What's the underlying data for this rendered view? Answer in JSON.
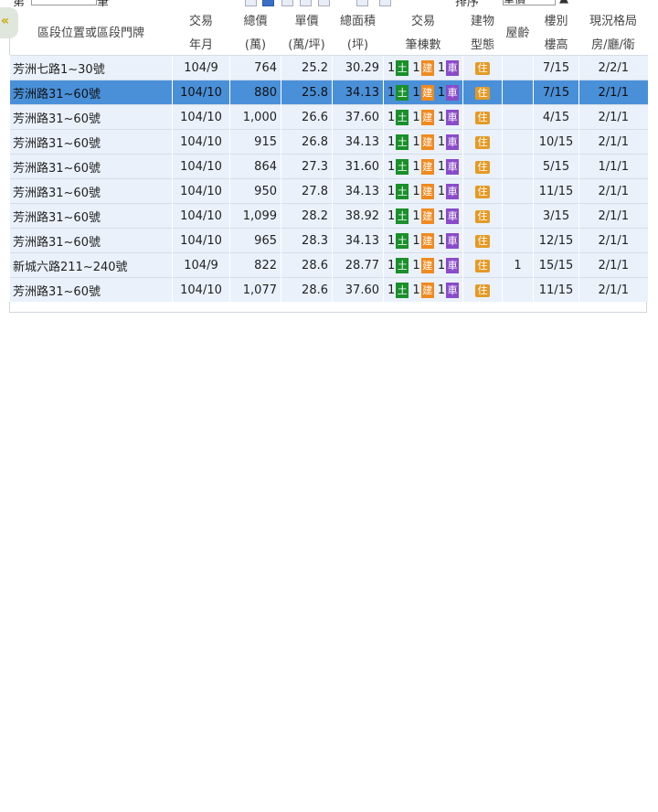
{
  "top_strip": {
    "prefix": "第",
    "suffix": "筆",
    "sort_label": "排序",
    "sort_value": "單價"
  },
  "collapse_label": "«",
  "headers": {
    "address": "區段位置或區段門牌",
    "date": [
      "交易",
      "年月"
    ],
    "total": [
      "總價",
      "(萬)"
    ],
    "unit": [
      "單價",
      "(萬/坪)"
    ],
    "area": [
      "總面積",
      "(坪)"
    ],
    "count": [
      "交易",
      "筆棟數"
    ],
    "type": [
      "建物",
      "型態"
    ],
    "age": "屋齡",
    "floor": [
      "樓別",
      "樓高"
    ],
    "layout": [
      "現況格局",
      "房/廳/衛"
    ]
  },
  "badges": {
    "land": "土",
    "building": "建",
    "parking": "車",
    "residential": "住"
  },
  "rows": [
    {
      "addr": "芳洲七路1~30號",
      "date": "104/9",
      "total": "764",
      "unit": "25.2",
      "area": "30.29",
      "land": "1",
      "bldg": "1",
      "park": "1",
      "type": "住",
      "age": "",
      "floor": "7/15",
      "layout": "2/2/1"
    },
    {
      "addr": "芳洲路31~60號",
      "date": "104/10",
      "total": "880",
      "unit": "25.8",
      "area": "34.13",
      "land": "1",
      "bldg": "1",
      "park": "1",
      "type": "住",
      "age": "",
      "floor": "7/15",
      "layout": "2/1/1"
    },
    {
      "addr": "芳洲路31~60號",
      "date": "104/10",
      "total": "1,000",
      "unit": "26.6",
      "area": "37.60",
      "land": "1",
      "bldg": "1",
      "park": "1",
      "type": "住",
      "age": "",
      "floor": "4/15",
      "layout": "2/1/1"
    },
    {
      "addr": "芳洲路31~60號",
      "date": "104/10",
      "total": "915",
      "unit": "26.8",
      "area": "34.13",
      "land": "1",
      "bldg": "1",
      "park": "1",
      "type": "住",
      "age": "",
      "floor": "10/15",
      "layout": "2/1/1"
    },
    {
      "addr": "芳洲路31~60號",
      "date": "104/10",
      "total": "864",
      "unit": "27.3",
      "area": "31.60",
      "land": "1",
      "bldg": "1",
      "park": "1",
      "type": "住",
      "age": "",
      "floor": "5/15",
      "layout": "1/1/1"
    },
    {
      "addr": "芳洲路31~60號",
      "date": "104/10",
      "total": "950",
      "unit": "27.8",
      "area": "34.13",
      "land": "1",
      "bldg": "1",
      "park": "1",
      "type": "住",
      "age": "",
      "floor": "11/15",
      "layout": "2/1/1"
    },
    {
      "addr": "芳洲路31~60號",
      "date": "104/10",
      "total": "1,099",
      "unit": "28.2",
      "area": "38.92",
      "land": "1",
      "bldg": "1",
      "park": "1",
      "type": "住",
      "age": "",
      "floor": "3/15",
      "layout": "2/1/1"
    },
    {
      "addr": "芳洲路31~60號",
      "date": "104/10",
      "total": "965",
      "unit": "28.3",
      "area": "34.13",
      "land": "1",
      "bldg": "1",
      "park": "1",
      "type": "住",
      "age": "",
      "floor": "12/15",
      "layout": "2/1/1"
    },
    {
      "addr": "新城六路211~240號",
      "date": "104/9",
      "total": "822",
      "unit": "28.6",
      "area": "28.77",
      "land": "1",
      "bldg": "1",
      "park": "1",
      "type": "住",
      "age": "1",
      "floor": "15/15",
      "layout": "2/1/1"
    },
    {
      "addr": "芳洲路31~60號",
      "date": "104/10",
      "total": "1,077",
      "unit": "28.6",
      "area": "37.60",
      "land": "1",
      "bldg": "1",
      "park": "1",
      "type": "住",
      "age": "",
      "floor": "11/15",
      "layout": "2/1/1"
    }
  ],
  "selected_row": 1
}
